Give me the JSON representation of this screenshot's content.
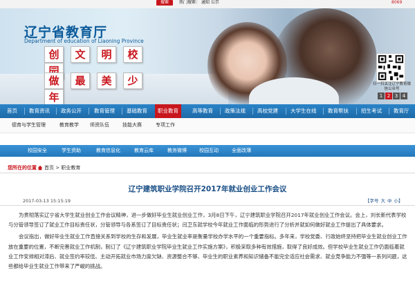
{
  "topbar": {
    "search_label": "搜索",
    "hot_prefix": "热门搜索：",
    "hot_items": [
      "通知",
      "公示"
    ],
    "account_text": "8069"
  },
  "banner": {
    "logo_title": "辽宁省教育厅",
    "logo_sub": "Department of education of Liaoning Province",
    "slogan_row1": [
      "创",
      "文",
      "明",
      "校",
      "园"
    ],
    "slogan_row2": [
      "做",
      "最",
      "美",
      "少",
      "年"
    ],
    "qr_caption": "扫一扫关注辽宁教育微信公众号",
    "pager": [
      "1",
      "2",
      "3",
      "4"
    ]
  },
  "nav": {
    "items": [
      "首页",
      "教育资讯",
      "政务公开",
      "教育管理",
      "基础教育",
      "职业教育",
      "高等教育",
      "政策法规",
      "高校党建",
      "大学生在线",
      "教育帮扶",
      "招生考试",
      "教育厅"
    ],
    "active_index": 5
  },
  "subnav": {
    "items": [
      "德育与学生管理",
      "教育教学",
      "师资队伍",
      "技能大赛",
      "专项工作"
    ]
  },
  "quick": {
    "items": [
      "校园安全",
      "学生资助",
      "教育信息化",
      "教育云库",
      "教务微博",
      "校园互动",
      "全面改薄"
    ]
  },
  "breadcrumb": {
    "label": "您所在的位置",
    "home": "首页",
    "current": "职业教育"
  },
  "article": {
    "title": "辽宁建筑职业学院召开2017年就业创业工作会议",
    "date": "2017-03-13 15:15:19",
    "size_label": "【字号",
    "size_options": [
      "大",
      "中",
      "小】"
    ],
    "paragraphs": [
      "为贯彻落实辽宁省大学生就业创业工作会议精神，进一步做好毕业生就业创业工作，3月8日下午，辽宁建筑职业学院召开2017年就业创业工作会议。会上，刘长新代表学校与分管领导签订了就业工作目标责任状，分管领导与各系签订了目标责任状；闫卫东就学校今年就业工作面临的形势进行了分析并就如何做好就业工作提出了具体要求。",
      "会议指出，做好毕业生就业工作直接关系到学校的生存和发展，毕业生就业率是衡量学校办学水平的一个重要指标。多年来，学校党委、行政始终坚持把毕业生就业创业工作放在重要的位置，不断完善就业工作机制，制订了《辽宁建筑职业学院毕业生就业工作实施方案》，积极采取多种有效措施，取得了良好成效。但学校毕业生就业工作仍面临着就业工作安排相对滞后、就业签约率较低、主动开拓就业市场力度欠缺、资源整合不够、毕业生的职业素养和知识储备不能完全适应社会需求、就业竞争能力不强等一系列问题，这些都给毕业生就业工作带来了严峻的挑战。"
    ]
  },
  "colors": {
    "nav_blue": "#1e6aa8",
    "brand_red": "#c8161d",
    "title_blue": "#1a4f86"
  }
}
